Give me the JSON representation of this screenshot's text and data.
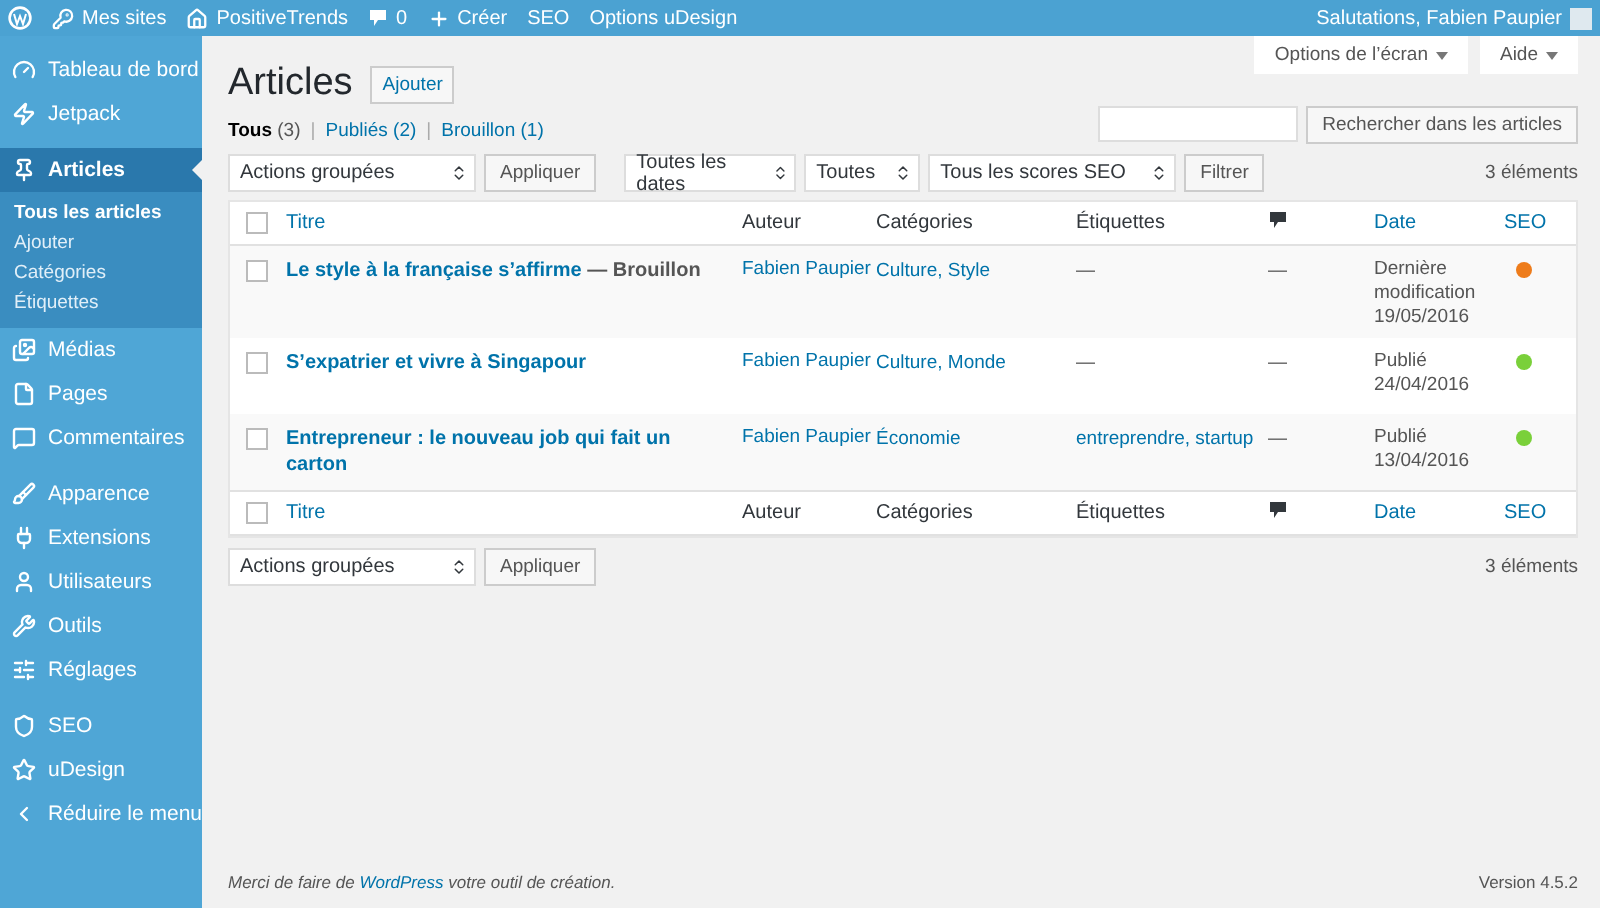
{
  "admin_bar": {
    "items": [
      {
        "kind": "logo"
      },
      {
        "kind": "sites",
        "label": "Mes sites"
      },
      {
        "kind": "home",
        "label": "PositiveTrends"
      },
      {
        "kind": "comments",
        "label": "0"
      },
      {
        "kind": "new",
        "label": "Créer"
      },
      {
        "kind": "text",
        "label": "SEO"
      },
      {
        "kind": "text",
        "label": "Options uDesign"
      }
    ],
    "greeting": "Salutations, Fabien Paupier"
  },
  "sidebar": {
    "groups": [
      [
        {
          "label": "Tableau de bord",
          "selected": false
        },
        {
          "label": "Jetpack",
          "selected": false
        }
      ],
      [
        {
          "label": "Articles",
          "selected": true,
          "children": [
            {
              "label": "Tous les articles",
              "selected": true
            },
            {
              "label": "Ajouter",
              "selected": false
            },
            {
              "label": "Catégories",
              "selected": false
            },
            {
              "label": "Étiquettes",
              "selected": false
            }
          ]
        },
        {
          "label": "Médias",
          "selected": false
        },
        {
          "label": "Pages",
          "selected": false
        },
        {
          "label": "Commentaires",
          "selected": false
        }
      ],
      [
        {
          "label": "Apparence",
          "selected": false
        },
        {
          "label": "Extensions",
          "selected": false
        },
        {
          "label": "Utilisateurs",
          "selected": false
        },
        {
          "label": "Outils",
          "selected": false
        },
        {
          "label": "Réglages",
          "selected": false
        }
      ],
      [
        {
          "label": "SEO",
          "selected": false
        },
        {
          "label": "uDesign",
          "selected": false
        },
        {
          "label": "Réduire le menu",
          "selected": false
        }
      ]
    ]
  },
  "screen_tabs": [
    "Options de l’écran",
    "Aide"
  ],
  "page_title": "Articles",
  "add_button": "Ajouter",
  "view_separator": "|",
  "views": [
    {
      "label": "Tous",
      "count": "(3)",
      "selected": true
    },
    {
      "label": "Publiés",
      "count": "(2)",
      "selected": false
    },
    {
      "label": "Brouillon",
      "count": "(1)",
      "selected": false
    }
  ],
  "search": {
    "button": "Rechercher dans les articles"
  },
  "filters": {
    "bulk": "Actions groupées",
    "apply": "Appliquer",
    "selects": [
      "Toutes les dates",
      "Toutes",
      "Tous les scores SEO"
    ],
    "filter": "Filtrer",
    "count": "3 éléments"
  },
  "table": {
    "header_checked": false,
    "footer_checked": false,
    "columns": [
      {
        "kind": "text",
        "label": "Titre",
        "sortable": true
      },
      {
        "kind": "text",
        "label": "Auteur",
        "sortable": false
      },
      {
        "kind": "text",
        "label": "Catégories",
        "sortable": false
      },
      {
        "kind": "text",
        "label": "Étiquettes",
        "sortable": false
      },
      {
        "kind": "icon"
      },
      {
        "kind": "text",
        "label": "Date",
        "sortable": true
      },
      {
        "kind": "text",
        "label": "SEO",
        "sortable": true
      }
    ],
    "rows": [
      {
        "title": "Le style à la française s’affirme",
        "state_label": "— Brouillon",
        "author": "Fabien Paupier",
        "categories": "Culture, Style",
        "tags": "—",
        "comments": "—",
        "status": "Dernière modification",
        "date": "19/05/2016",
        "color": "#ee7c1b",
        "checked": false
      },
      {
        "title": "S’expatrier et vivre à Singapour",
        "author": "Fabien Paupier",
        "categories": "Culture, Monde",
        "tags": "—",
        "comments": "—",
        "status": "Publié",
        "date": "24/04/2016",
        "color": "#7ad03a",
        "checked": false
      },
      {
        "title": "Entrepreneur : le nouveau job qui fait un carton",
        "author": "Fabien Paupier",
        "categories": "Économie",
        "tags": "entreprendre, startup",
        "comments": "—",
        "status": "Publié",
        "date": "13/04/2016",
        "color": "#7ad03a",
        "checked": false
      }
    ],
    "footer_columns": [
      {
        "kind": "text",
        "label": "Titre",
        "sortable": true
      },
      {
        "kind": "text",
        "label": "Auteur",
        "sortable": false
      },
      {
        "kind": "text",
        "label": "Catégories",
        "sortable": false
      },
      {
        "kind": "text",
        "label": "Étiquettes",
        "sortable": false
      },
      {
        "kind": "icon"
      },
      {
        "kind": "text",
        "label": "Date",
        "sortable": true
      },
      {
        "kind": "text",
        "label": "SEO",
        "sortable": true
      }
    ]
  },
  "bottom_filters": {
    "bulk": "Actions groupées",
    "apply": "Appliquer",
    "count": "3 éléments"
  },
  "credit": {
    "before": "Merci de faire de",
    "link": "WordPress",
    "after": "votre outil de création."
  },
  "version": "Version 4.5.2"
}
